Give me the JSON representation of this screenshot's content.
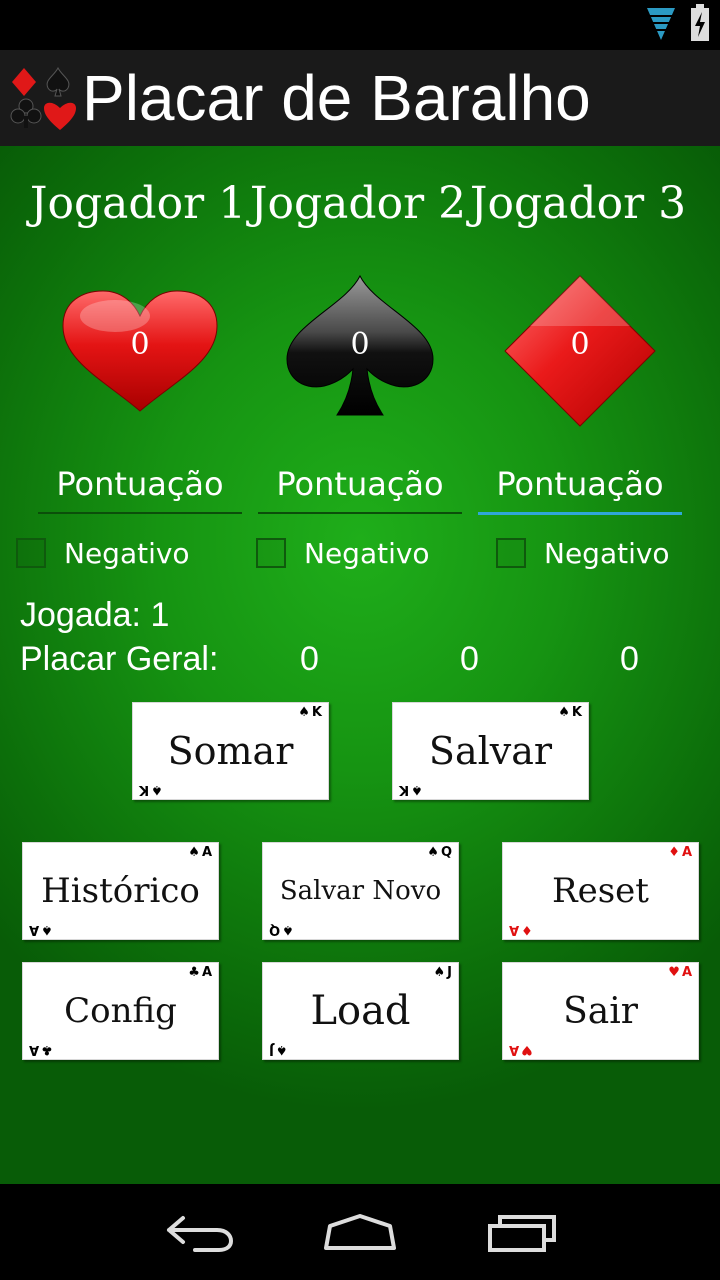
{
  "app": {
    "title": "Placar de Baralho"
  },
  "players": [
    {
      "name": "Jogador 1",
      "suit": "heart",
      "score": "0",
      "placeholder": "Pontuação",
      "negative_label": "Negativo"
    },
    {
      "name": "Jogador 2",
      "suit": "spade",
      "score": "0",
      "placeholder": "Pontuação",
      "negative_label": "Negativo"
    },
    {
      "name": "Jogador 3",
      "suit": "diamond",
      "score": "0",
      "placeholder": "Pontuação",
      "negative_label": "Negativo"
    }
  ],
  "jogada": "Jogada: 1",
  "placar": {
    "label": "Placar Geral:",
    "values": [
      "0",
      "0",
      "0"
    ]
  },
  "buttons": {
    "somar": {
      "label": "Somar",
      "rank": "K",
      "suit": "♠",
      "color": "black"
    },
    "salvar": {
      "label": "Salvar",
      "rank": "K",
      "suit": "♠",
      "color": "black"
    },
    "historico": {
      "label": "Histórico",
      "rank": "A",
      "suit": "♠",
      "color": "black"
    },
    "salvar_novo": {
      "label": "Salvar Novo",
      "rank": "Q",
      "suit": "♠",
      "color": "black"
    },
    "reset": {
      "label": "Reset",
      "rank": "A",
      "suit": "♦",
      "color": "red"
    },
    "config": {
      "label": "Config",
      "rank": "A",
      "suit": "♣",
      "color": "black"
    },
    "load": {
      "label": "Load",
      "rank": "J",
      "suit": "♠",
      "color": "black"
    },
    "sair": {
      "label": "Sair",
      "rank": "A",
      "suit": "♥",
      "color": "red"
    }
  },
  "colors": {
    "felt": "#169412",
    "focus": "#2fa7d8",
    "red": "#e01010"
  }
}
